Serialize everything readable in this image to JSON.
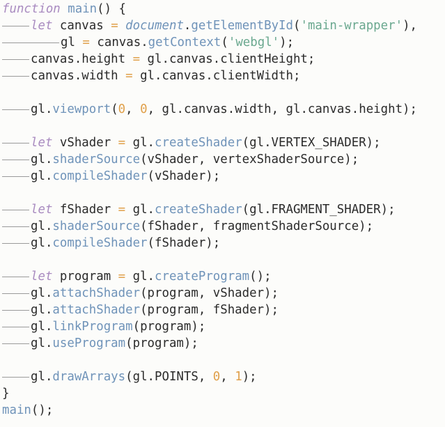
{
  "colors": {
    "keyword": "#a98bc0",
    "function": "#6f93b9",
    "string": "#6aa88f",
    "number": "#e0a04a",
    "plain": "#2b2b2b",
    "background": "#fcfcfa"
  },
  "code": {
    "lines": [
      {
        "indent": 0,
        "tokens": [
          {
            "t": "function",
            "c": "kw"
          },
          {
            "t": " ",
            "c": "pl"
          },
          {
            "t": "main",
            "c": "fn"
          },
          {
            "t": "() {",
            "c": "pl"
          }
        ]
      },
      {
        "indent": 1,
        "tokens": [
          {
            "t": "let",
            "c": "kw"
          },
          {
            "t": " canvas ",
            "c": "pl"
          },
          {
            "t": "=",
            "c": "op"
          },
          {
            "t": " ",
            "c": "pl"
          },
          {
            "t": "document",
            "c": "obj"
          },
          {
            "t": ".",
            "c": "pl"
          },
          {
            "t": "getElementById",
            "c": "fn"
          },
          {
            "t": "(",
            "c": "pl"
          },
          {
            "t": "'main-wrapper'",
            "c": "str"
          },
          {
            "t": "),",
            "c": "pl"
          }
        ]
      },
      {
        "indent": 2,
        "tokens": [
          {
            "t": "gl ",
            "c": "pl"
          },
          {
            "t": "=",
            "c": "op"
          },
          {
            "t": " canvas.",
            "c": "pl"
          },
          {
            "t": "getContext",
            "c": "fn"
          },
          {
            "t": "(",
            "c": "pl"
          },
          {
            "t": "'webgl'",
            "c": "str"
          },
          {
            "t": ");",
            "c": "pl"
          }
        ]
      },
      {
        "indent": 1,
        "tokens": [
          {
            "t": "canvas.height ",
            "c": "pl"
          },
          {
            "t": "=",
            "c": "op"
          },
          {
            "t": " gl.canvas.clientHeight;",
            "c": "pl"
          }
        ]
      },
      {
        "indent": 1,
        "tokens": [
          {
            "t": "canvas.width ",
            "c": "pl"
          },
          {
            "t": "=",
            "c": "op"
          },
          {
            "t": " gl.canvas.clientWidth;",
            "c": "pl"
          }
        ]
      },
      {
        "indent": 0,
        "tokens": []
      },
      {
        "indent": 1,
        "tokens": [
          {
            "t": "gl.",
            "c": "pl"
          },
          {
            "t": "viewport",
            "c": "fn"
          },
          {
            "t": "(",
            "c": "pl"
          },
          {
            "t": "0",
            "c": "num"
          },
          {
            "t": ", ",
            "c": "pl"
          },
          {
            "t": "0",
            "c": "num"
          },
          {
            "t": ", gl.canvas.width, gl.canvas.height);",
            "c": "pl"
          }
        ]
      },
      {
        "indent": 0,
        "tokens": []
      },
      {
        "indent": 1,
        "tokens": [
          {
            "t": "let",
            "c": "kw"
          },
          {
            "t": " vShader ",
            "c": "pl"
          },
          {
            "t": "=",
            "c": "op"
          },
          {
            "t": " gl.",
            "c": "pl"
          },
          {
            "t": "createShader",
            "c": "fn"
          },
          {
            "t": "(gl.VERTEX_SHADER);",
            "c": "pl"
          }
        ]
      },
      {
        "indent": 1,
        "tokens": [
          {
            "t": "gl.",
            "c": "pl"
          },
          {
            "t": "shaderSource",
            "c": "fn"
          },
          {
            "t": "(vShader, vertexShaderSource);",
            "c": "pl"
          }
        ]
      },
      {
        "indent": 1,
        "tokens": [
          {
            "t": "gl.",
            "c": "pl"
          },
          {
            "t": "compileShader",
            "c": "fn"
          },
          {
            "t": "(vShader);",
            "c": "pl"
          }
        ]
      },
      {
        "indent": 0,
        "tokens": []
      },
      {
        "indent": 1,
        "tokens": [
          {
            "t": "let",
            "c": "kw"
          },
          {
            "t": " fShader ",
            "c": "pl"
          },
          {
            "t": "=",
            "c": "op"
          },
          {
            "t": " gl.",
            "c": "pl"
          },
          {
            "t": "createShader",
            "c": "fn"
          },
          {
            "t": "(gl.FRAGMENT_SHADER);",
            "c": "pl"
          }
        ]
      },
      {
        "indent": 1,
        "tokens": [
          {
            "t": "gl.",
            "c": "pl"
          },
          {
            "t": "shaderSource",
            "c": "fn"
          },
          {
            "t": "(fShader, fragmentShaderSource);",
            "c": "pl"
          }
        ]
      },
      {
        "indent": 1,
        "tokens": [
          {
            "t": "gl.",
            "c": "pl"
          },
          {
            "t": "compileShader",
            "c": "fn"
          },
          {
            "t": "(fShader);",
            "c": "pl"
          }
        ]
      },
      {
        "indent": 0,
        "tokens": []
      },
      {
        "indent": 1,
        "tokens": [
          {
            "t": "let",
            "c": "kw"
          },
          {
            "t": " program ",
            "c": "pl"
          },
          {
            "t": "=",
            "c": "op"
          },
          {
            "t": " gl.",
            "c": "pl"
          },
          {
            "t": "createProgram",
            "c": "fn"
          },
          {
            "t": "();",
            "c": "pl"
          }
        ]
      },
      {
        "indent": 1,
        "tokens": [
          {
            "t": "gl.",
            "c": "pl"
          },
          {
            "t": "attachShader",
            "c": "fn"
          },
          {
            "t": "(program, vShader);",
            "c": "pl"
          }
        ]
      },
      {
        "indent": 1,
        "tokens": [
          {
            "t": "gl.",
            "c": "pl"
          },
          {
            "t": "attachShader",
            "c": "fn"
          },
          {
            "t": "(program, fShader);",
            "c": "pl"
          }
        ]
      },
      {
        "indent": 1,
        "tokens": [
          {
            "t": "gl.",
            "c": "pl"
          },
          {
            "t": "linkProgram",
            "c": "fn"
          },
          {
            "t": "(program);",
            "c": "pl"
          }
        ]
      },
      {
        "indent": 1,
        "tokens": [
          {
            "t": "gl.",
            "c": "pl"
          },
          {
            "t": "useProgram",
            "c": "fn"
          },
          {
            "t": "(program);",
            "c": "pl"
          }
        ]
      },
      {
        "indent": 0,
        "tokens": []
      },
      {
        "indent": 1,
        "tokens": [
          {
            "t": "gl.",
            "c": "pl"
          },
          {
            "t": "drawArrays",
            "c": "fn"
          },
          {
            "t": "(gl.POINTS, ",
            "c": "pl"
          },
          {
            "t": "0",
            "c": "num"
          },
          {
            "t": ", ",
            "c": "pl"
          },
          {
            "t": "1",
            "c": "num"
          },
          {
            "t": ");",
            "c": "pl"
          }
        ]
      },
      {
        "indent": 0,
        "tokens": [
          {
            "t": "}",
            "c": "pl"
          }
        ]
      },
      {
        "indent": 0,
        "tokens": [
          {
            "t": "main",
            "c": "fn"
          },
          {
            "t": "();",
            "c": "pl"
          }
        ]
      }
    ]
  }
}
